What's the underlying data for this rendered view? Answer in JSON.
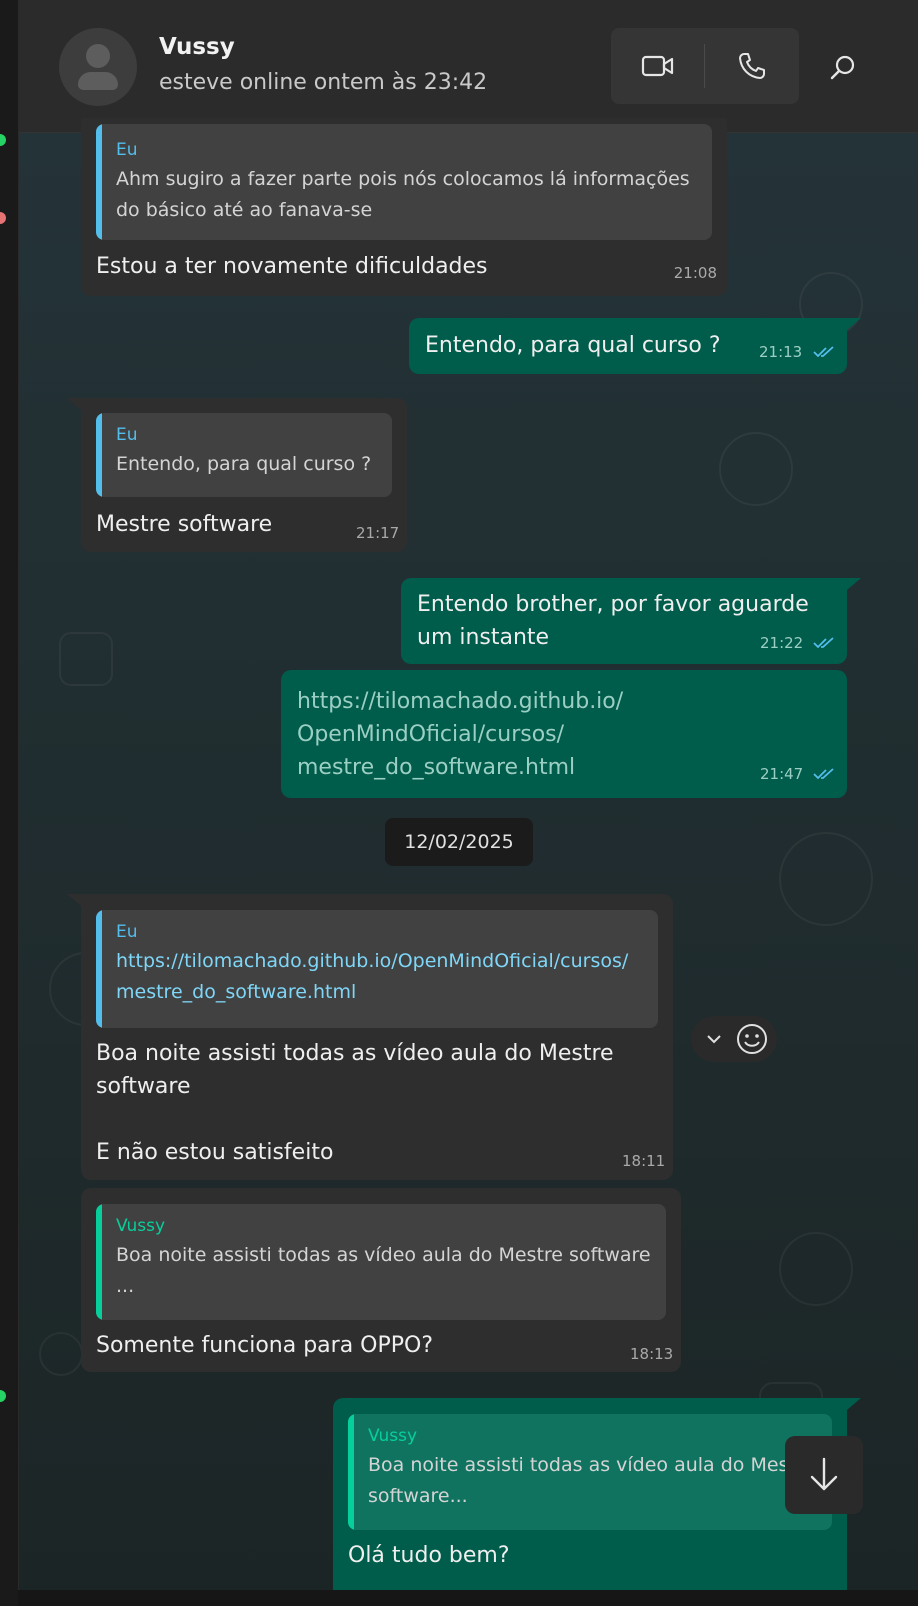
{
  "header": {
    "contact_name": "Vussy",
    "status": "esteve online ontem às 23:42"
  },
  "icons": {
    "video": "video-camera-icon",
    "phone": "phone-icon",
    "search": "search-icon",
    "emoji": "emoji-icon",
    "chevron": "chevron-down-icon",
    "scroll": "arrow-down-icon"
  },
  "colors": {
    "incoming_bubble": "#2e2e2e",
    "outgoing_bubble": "#005c4b",
    "quote_bar_self": "#53bdeb",
    "quote_bar_contact": "#06cf9c",
    "read_ticks": "#53bdeb"
  },
  "messages": [
    {
      "direction": "in",
      "quote_name": "Eu",
      "quote_text": "Ahm sugiro a fazer parte pois nós colocamos lá informações do básico até ao fanava-se",
      "text": "Estou a ter novamente dificuldades",
      "time": "21:08"
    },
    {
      "direction": "out",
      "text": "Entendo, para qual curso ?",
      "time": "21:13"
    },
    {
      "direction": "in",
      "quote_name": "Eu",
      "quote_text": "Entendo, para qual curso ?",
      "text": "Mestre software",
      "time": "21:17"
    },
    {
      "direction": "out",
      "text": "Entendo brother, por favor aguarde um instante",
      "time": "21:22"
    },
    {
      "direction": "out",
      "text": "https://tilomachado.github.io/\nOpenMindOficial/cursos/\nmestre_do_software.html",
      "time": "21:47"
    },
    {
      "direction": "in",
      "quote_name": "Eu",
      "quote_text": "https://tilomachado.github.io/OpenMindOficial/cursos/mestre_do_software.html",
      "text": "Boa noite assisti todas as vídeo aula do Mestre software\n\nE não estou satisfeito",
      "time": "18:11"
    },
    {
      "direction": "in",
      "quote_name": "Vussy",
      "quote_text": "Boa noite assisti todas as vídeo aula do Mestre software ...",
      "text": "Somente funciona para OPPO?",
      "time": "18:13"
    },
    {
      "direction": "out",
      "quote_name": "Vussy",
      "quote_text": "Boa noite assisti todas as vídeo aula do Mestre software...",
      "text": "Olá tudo bem?",
      "time": ""
    }
  ],
  "date_separator": "12/02/2025"
}
